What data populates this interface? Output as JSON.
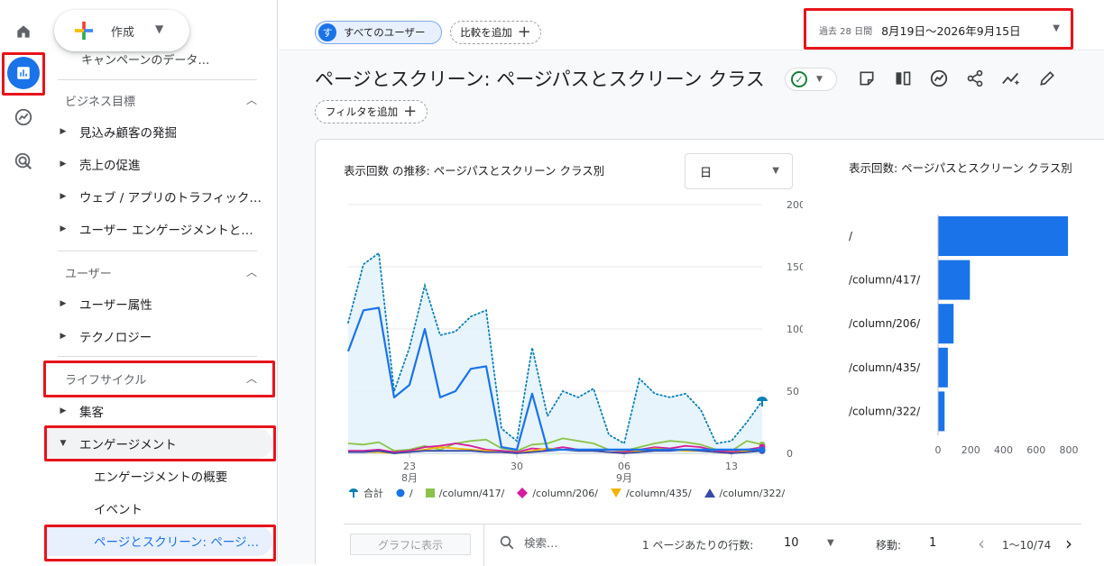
{
  "sidebar": {
    "create_label": "作成",
    "cut_item": "キャンペーンのデータ…",
    "sections": [
      {
        "title": "ビジネス目標",
        "items": [
          "見込み顧客の発掘",
          "売上の促進",
          "ウェブ / アプリのトラフィック…",
          "ユーザー エンゲージメントと…"
        ]
      },
      {
        "title": "ユーザー",
        "items": [
          "ユーザー属性",
          "テクノロジー"
        ]
      },
      {
        "title": "ライフサイクル",
        "items": [
          "集客",
          "エンゲージメント"
        ]
      }
    ],
    "sub_items": [
      "エンゲージメントの概要",
      "イベント",
      "ページとスクリーン: ページ…"
    ]
  },
  "topbar": {
    "user_chip_avatar": "す",
    "user_chip_label": "すべてのユーザー",
    "compare_label": "比較を追加",
    "date_prefix": "過去 28 日間",
    "date_value": "8月19日〜2026年9月15日"
  },
  "header": {
    "title": "ページとスクリーン: ページパスとスクリーン クラス",
    "filter_label": "フィルタを追加"
  },
  "card": {
    "chart_title": "表示回数 の推移: ページパスとスクリーン クラス別",
    "granularity": "日",
    "bar_title": "表示回数: ページパスとスクリーン クラス別"
  },
  "table_bar": {
    "graph_button": "グラフに表示",
    "search_placeholder": "検索…",
    "rows_label": "1 ページあたりの行数:",
    "rows_value": "10",
    "goto_label": "移動:",
    "goto_value": "1",
    "range": "1〜10/74"
  },
  "colors": {
    "total": "#0b80b6",
    "root": "#1a73e8",
    "p417": "#8bc34a",
    "p206": "#d81b9c",
    "p435": "#f4b400",
    "p322": "#3949ab"
  },
  "chart_data": [
    {
      "type": "line",
      "title": "表示回数 の推移: ページパスとスクリーン クラス別",
      "x_ticks": [
        {
          "day": 23,
          "label": "23",
          "month": "8月"
        },
        {
          "day": 30,
          "label": "30"
        },
        {
          "day": 37,
          "label": "06",
          "month": "9月"
        },
        {
          "day": 44,
          "label": "13"
        }
      ],
      "x_domain": [
        19,
        46
      ],
      "y_ticks": [
        "0",
        "50",
        "100",
        "150",
        "200"
      ],
      "ylim": [
        0,
        200
      ],
      "series": [
        {
          "name": "合計",
          "key": "total",
          "style": "dotted-area",
          "values": [
            105,
            152,
            161,
            50,
            85,
            135,
            95,
            98,
            110,
            115,
            20,
            10,
            85,
            30,
            50,
            45,
            52,
            15,
            8,
            60,
            48,
            45,
            48,
            35,
            8,
            10,
            25,
            42
          ]
        },
        {
          "name": "/",
          "key": "root",
          "values": [
            82,
            115,
            117,
            45,
            55,
            100,
            45,
            50,
            68,
            70,
            5,
            3,
            48,
            3,
            3,
            3,
            3,
            3,
            3,
            3,
            3,
            3,
            3,
            3,
            3,
            3,
            3,
            3
          ]
        },
        {
          "name": "/column/417/",
          "key": "p417",
          "values": [
            8,
            7,
            9,
            2,
            3,
            6,
            3,
            8,
            10,
            11,
            4,
            2,
            7,
            8,
            12,
            10,
            8,
            3,
            2,
            5,
            8,
            10,
            9,
            7,
            3,
            2,
            10,
            7
          ]
        },
        {
          "name": "/column/206/",
          "key": "p206",
          "values": [
            2,
            2,
            3,
            1,
            2,
            5,
            6,
            8,
            6,
            3,
            2,
            1,
            4,
            3,
            5,
            3,
            2,
            1,
            1,
            3,
            5,
            4,
            6,
            5,
            2,
            1,
            3,
            5
          ]
        },
        {
          "name": "/column/435/",
          "key": "p435",
          "values": [
            1,
            1,
            1,
            0,
            1,
            3,
            5,
            4,
            3,
            2,
            1,
            0,
            2,
            4,
            3,
            2,
            2,
            1,
            0,
            2,
            4,
            3,
            2,
            2,
            1,
            0,
            2,
            3
          ]
        },
        {
          "name": "/column/322/",
          "key": "p322",
          "values": [
            1,
            1,
            2,
            0,
            1,
            2,
            2,
            2,
            2,
            1,
            1,
            0,
            1,
            2,
            3,
            2,
            2,
            1,
            0,
            1,
            2,
            2,
            3,
            2,
            1,
            0,
            1,
            2
          ]
        }
      ]
    },
    {
      "type": "bar",
      "title": "表示回数: ページパスとスクリーン クラス別",
      "orientation": "horizontal",
      "categories": [
        "/",
        "/column/417/",
        "/column/206/",
        "/column/435/",
        "/column/322/"
      ],
      "values": [
        795,
        195,
        95,
        60,
        40
      ],
      "x_ticks": [
        "0",
        "200",
        "400",
        "600",
        "800"
      ],
      "xlim": [
        0,
        800
      ]
    }
  ]
}
